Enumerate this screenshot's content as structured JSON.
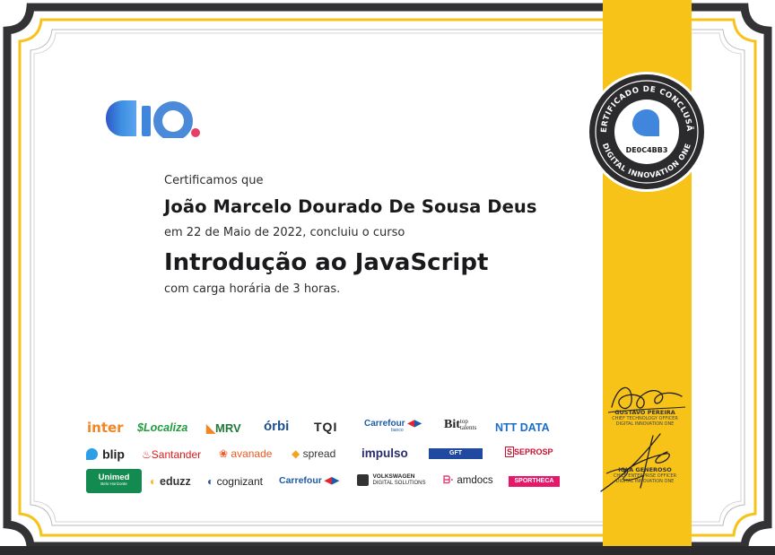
{
  "brand": {
    "logo_text": "dio."
  },
  "certificate": {
    "intro": "Certificamos que",
    "recipient": "João Marcelo Dourado De Sousa Deus",
    "date_line": "em 22 de Maio de 2022, concluiu o curso",
    "course_title": "Introdução ao JavaScript",
    "hours_line": "com carga horária de 3 horas."
  },
  "seal": {
    "top_text": "CERTIFICADO DE CONCLUSÃO",
    "bottom_text": "DIGITAL INNOVATION ONE",
    "code": "DE0C4BB3"
  },
  "signatures": [
    {
      "name": "GUSTAVO PEREIRA",
      "role_line1": "CHIEF TECHNOLOGY OFFICER",
      "role_line2": "DIGITAL INNOVATION ONE"
    },
    {
      "name": "IGLÁ GENEROSO",
      "role_line1": "CHIEF ENTERPRISE OFFICER",
      "role_line2": "DIGITAL INNOVATION ONE"
    }
  ],
  "partners": {
    "row1": [
      "inter",
      "Localiza",
      "MRV",
      "órbi",
      "TQI",
      "Carrefour",
      "banco",
      "Bit",
      "top talents",
      "NTT DATA"
    ],
    "row2": [
      "blip",
      "Santander",
      "avanade",
      "spread",
      "impulso",
      "GFT",
      "SEPROSP"
    ],
    "row3": [
      "Unimed",
      "Belo Horizonte",
      "eduzz",
      "cognizant",
      "Carrefour",
      "VOLKSWAGEN",
      "DIGITAL SOLUTIONS",
      "amdocs",
      "SPORTHECA"
    ]
  },
  "colors": {
    "ribbon": "#f8c319",
    "frame_dark": "#333335",
    "frame_yellow": "#f8c319",
    "dio_blue": "#4b8ad8",
    "dio_pink": "#e6406a"
  }
}
